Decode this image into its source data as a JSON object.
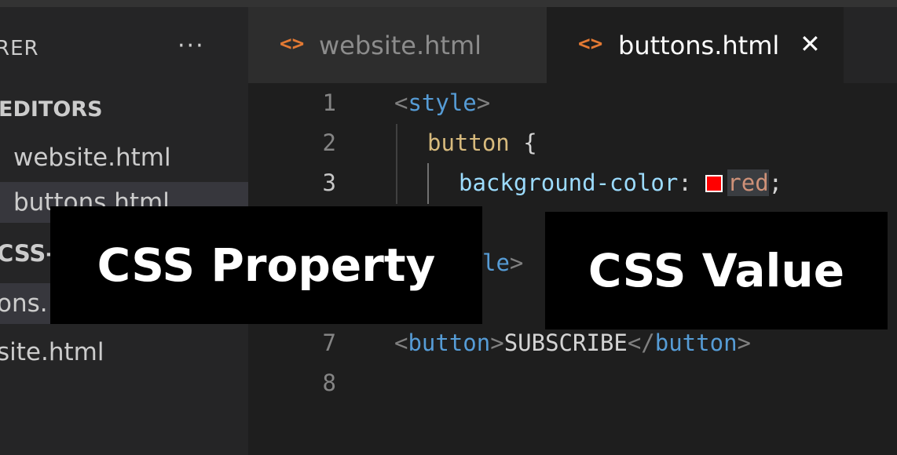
{
  "sidebar": {
    "header": "RER",
    "more": "···",
    "section": "EDITORS",
    "items": [
      {
        "label": "website.html"
      },
      {
        "label": "buttons.html"
      },
      {
        "label": "CSS-"
      },
      {
        "label": "ons."
      },
      {
        "label": "site.html"
      }
    ]
  },
  "tabs": [
    {
      "icon": "<>",
      "label": "website.html"
    },
    {
      "icon": "<>",
      "label": "buttons.html",
      "close": "✕"
    }
  ],
  "editor": {
    "line_numbers": [
      "1",
      "2",
      "3",
      "7",
      "8"
    ],
    "line1": {
      "open": "<",
      "tag": "style",
      "close": ">"
    },
    "line2": {
      "selector": "button",
      "brace": " {"
    },
    "line3": {
      "property": "background-color",
      "colon": ": ",
      "swatch_color": "#ff0000",
      "value": "red",
      "semi": ";"
    },
    "line6_partial": {
      "tag": "le",
      "close": ">"
    },
    "line7": {
      "open": "<",
      "tag": "button",
      "close": ">",
      "text": "SUBSCRIBE",
      "end_open": "</",
      "end_tag": "button",
      "end_close": ">"
    }
  },
  "overlays": {
    "property_label": "CSS Property",
    "value_label": "CSS Value"
  },
  "colors": {
    "tab_icon": "#e37933",
    "tag": "#569cd6",
    "selector": "#d7ba7d",
    "property": "#9cdcfe",
    "value": "#ce9178"
  }
}
